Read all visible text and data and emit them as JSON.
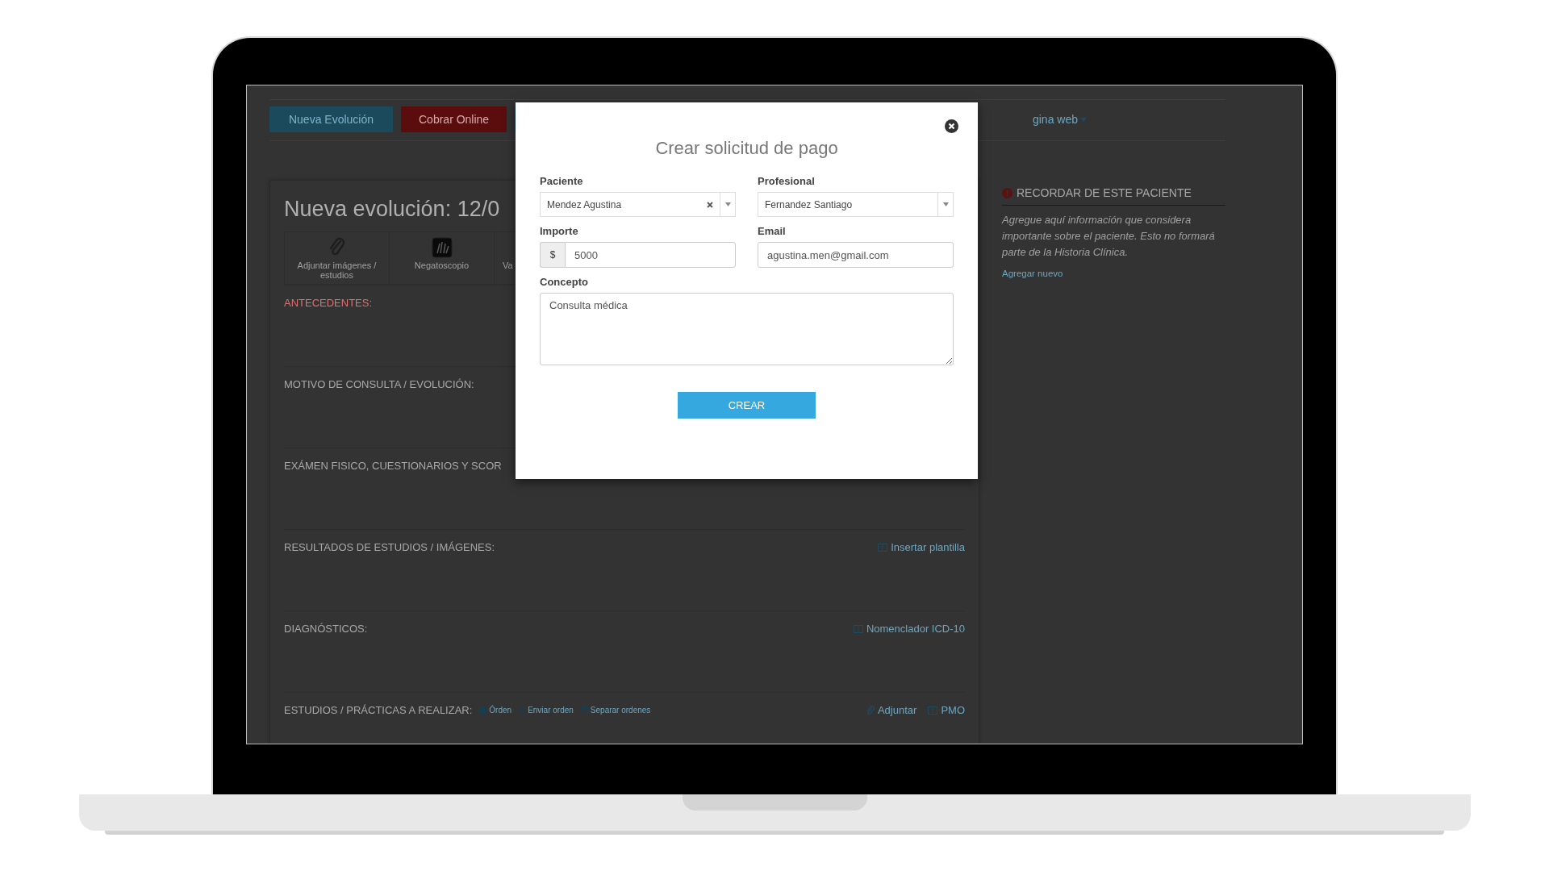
{
  "toolbar": {
    "buttons": [
      {
        "label": "Nueva Evolución",
        "kind": "primary"
      },
      {
        "label": "Cobrar Online",
        "kind": "danger"
      }
    ],
    "web_menu": {
      "label": "gina web"
    }
  },
  "evolution": {
    "title": "Nueva evolución: 12/0",
    "tools": [
      {
        "label": "Adjuntar imágenes / estudios",
        "kind": "clip"
      },
      {
        "label": "Negatoscopio",
        "kind": "xray"
      },
      {
        "label": "Va",
        "kind": "none"
      }
    ],
    "sections": [
      {
        "title": "ANTECEDENTES:",
        "kind": "alert"
      },
      {
        "title": "MOTIVO DE CONSULTA / EVOLUCIÓN:",
        "kind": "plain"
      },
      {
        "title": "EXÁMEN FISICO, CUESTIONARIOS Y SCOR",
        "kind": "plain"
      },
      {
        "title": "RESULTADOS DE ESTUDIOS / IMÁGENES:",
        "kind": "plain",
        "links": [
          {
            "label": "Insertar plantilla",
            "kind": "book"
          }
        ]
      },
      {
        "title": "DIAGNÓSTICOS:",
        "kind": "plain",
        "links": [
          {
            "label": "Nomenclador ICD-10",
            "kind": "book"
          }
        ]
      },
      {
        "title": "ESTUDIOS / PRÁCTICAS A REALIZAR:",
        "kind": "plain",
        "inline": [
          {
            "label": "Órden",
            "kind": "print"
          },
          {
            "label": "Enviar orden",
            "kind": "share"
          },
          {
            "label": "Separar ordenes",
            "kind": "copy"
          }
        ],
        "links": [
          {
            "label": "Adjuntar",
            "kind": "clip"
          },
          {
            "label": "PMO",
            "kind": "book"
          }
        ]
      }
    ]
  },
  "reminder": {
    "title": "RECORDAR DE ESTE PACIENTE",
    "text": "Agregue aquí información que considera importante sobre el paciente. Esto no formará parte de la Historia Clínica.",
    "link": "Agregar nuevo"
  },
  "modal": {
    "title": "Crear solicitud de pago",
    "fields": [
      {
        "label": "Paciente",
        "kind": "select",
        "value": "Mendez Agustina",
        "clearable": true
      },
      {
        "label": "Profesional",
        "kind": "select",
        "value": "Fernandez Santiago",
        "clearable": false
      },
      {
        "label": "Importe",
        "kind": "money",
        "prefix": "$",
        "value": "5000"
      },
      {
        "label": "Email",
        "kind": "text",
        "value": "agustina.men@gmail.com"
      },
      {
        "label": "Concepto",
        "kind": "textarea",
        "value": "Consulta médica"
      }
    ],
    "submit": "CREAR"
  }
}
